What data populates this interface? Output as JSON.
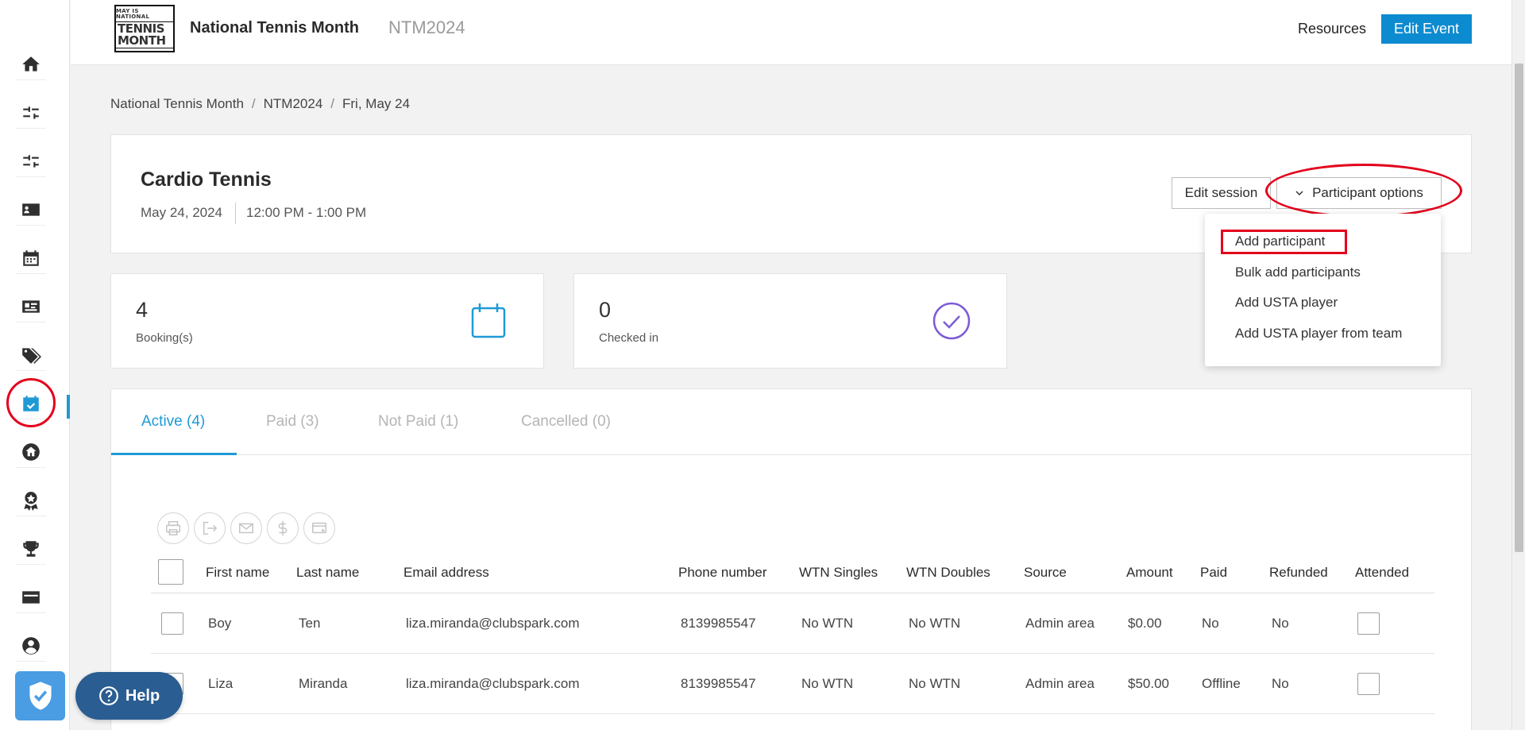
{
  "header": {
    "logo_text_small": "MAY IS NATIONAL",
    "logo_text_big": "TENNIS MONTH",
    "title": "National Tennis Month",
    "code": "NTM2024",
    "resources_label": "Resources",
    "edit_event_label": "Edit Event"
  },
  "sidebar": {
    "items": [
      {
        "icon": "home-icon"
      },
      {
        "icon": "sliders-icon"
      },
      {
        "icon": "sliders-icon"
      },
      {
        "icon": "contact-card-icon"
      },
      {
        "icon": "calendar-icon"
      },
      {
        "icon": "id-card-icon"
      },
      {
        "icon": "tags-icon"
      },
      {
        "icon": "calendar-check-icon",
        "active": true
      },
      {
        "icon": "venue-home-icon"
      },
      {
        "icon": "coach-award-icon"
      },
      {
        "icon": "trophy-icon"
      },
      {
        "icon": "ticket-icon"
      },
      {
        "icon": "user-account-icon"
      }
    ],
    "badge_icon": "shield-check-icon"
  },
  "breadcrumb": {
    "items": [
      "National Tennis Month",
      "NTM2024",
      "Fri, May 24"
    ],
    "separator": "/"
  },
  "session": {
    "title": "Cardio Tennis",
    "date": "May 24, 2024",
    "time": "12:00 PM - 1:00 PM",
    "edit_session_label": "Edit session",
    "participant_options_label": "Participant options"
  },
  "dropdown": {
    "items": [
      "Add participant",
      "Bulk add participants",
      "Add USTA player",
      "Add USTA player from team"
    ]
  },
  "stats": {
    "bookings": {
      "value": "4",
      "label": "Booking(s)"
    },
    "checked_in": {
      "value": "0",
      "label": "Checked in"
    }
  },
  "tabs": [
    {
      "label": "Active (4)",
      "active": true
    },
    {
      "label": "Paid (3)"
    },
    {
      "label": "Not Paid (1)"
    },
    {
      "label": "Cancelled (0)"
    }
  ],
  "table": {
    "columns": [
      "First name",
      "Last name",
      "Email address",
      "Phone number",
      "WTN Singles",
      "WTN Doubles",
      "Source",
      "Amount",
      "Paid",
      "Refunded",
      "Attended"
    ],
    "rows": [
      [
        "Boy",
        "Ten",
        "liza.miranda@clubspark.com",
        "8139985547",
        "No WTN",
        "No WTN",
        "Admin area",
        "$0.00",
        "No",
        "No"
      ],
      [
        "Liza",
        "Miranda",
        "liza.miranda@clubspark.com",
        "8139985547",
        "No WTN",
        "No WTN",
        "Admin area",
        "$50.00",
        "Offline",
        "No"
      ]
    ]
  },
  "help": {
    "label": "Help"
  },
  "colors": {
    "accent": "#1e9ad6",
    "annotation": "#e3001b",
    "check_icon": "#7c5cd6"
  }
}
